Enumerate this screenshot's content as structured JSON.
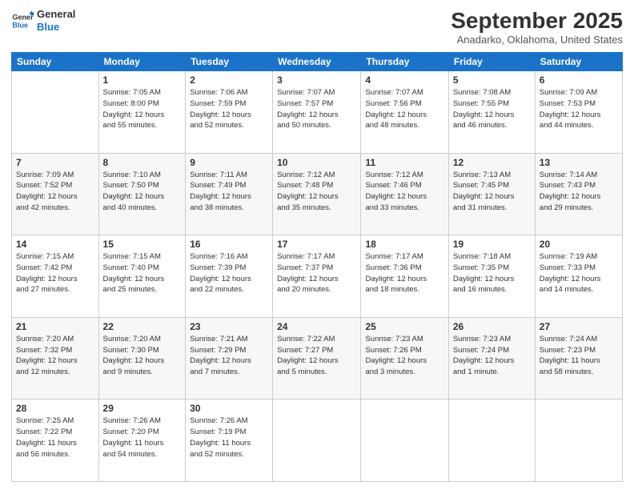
{
  "header": {
    "logo_line1": "General",
    "logo_line2": "Blue",
    "month": "September 2025",
    "location": "Anadarko, Oklahoma, United States"
  },
  "weekdays": [
    "Sunday",
    "Monday",
    "Tuesday",
    "Wednesday",
    "Thursday",
    "Friday",
    "Saturday"
  ],
  "weeks": [
    [
      {
        "day": "",
        "info": ""
      },
      {
        "day": "1",
        "info": "Sunrise: 7:05 AM\nSunset: 8:00 PM\nDaylight: 12 hours\nand 55 minutes."
      },
      {
        "day": "2",
        "info": "Sunrise: 7:06 AM\nSunset: 7:59 PM\nDaylight: 12 hours\nand 52 minutes."
      },
      {
        "day": "3",
        "info": "Sunrise: 7:07 AM\nSunset: 7:57 PM\nDaylight: 12 hours\nand 50 minutes."
      },
      {
        "day": "4",
        "info": "Sunrise: 7:07 AM\nSunset: 7:56 PM\nDaylight: 12 hours\nand 48 minutes."
      },
      {
        "day": "5",
        "info": "Sunrise: 7:08 AM\nSunset: 7:55 PM\nDaylight: 12 hours\nand 46 minutes."
      },
      {
        "day": "6",
        "info": "Sunrise: 7:09 AM\nSunset: 7:53 PM\nDaylight: 12 hours\nand 44 minutes."
      }
    ],
    [
      {
        "day": "7",
        "info": "Sunrise: 7:09 AM\nSunset: 7:52 PM\nDaylight: 12 hours\nand 42 minutes."
      },
      {
        "day": "8",
        "info": "Sunrise: 7:10 AM\nSunset: 7:50 PM\nDaylight: 12 hours\nand 40 minutes."
      },
      {
        "day": "9",
        "info": "Sunrise: 7:11 AM\nSunset: 7:49 PM\nDaylight: 12 hours\nand 38 minutes."
      },
      {
        "day": "10",
        "info": "Sunrise: 7:12 AM\nSunset: 7:48 PM\nDaylight: 12 hours\nand 35 minutes."
      },
      {
        "day": "11",
        "info": "Sunrise: 7:12 AM\nSunset: 7:46 PM\nDaylight: 12 hours\nand 33 minutes."
      },
      {
        "day": "12",
        "info": "Sunrise: 7:13 AM\nSunset: 7:45 PM\nDaylight: 12 hours\nand 31 minutes."
      },
      {
        "day": "13",
        "info": "Sunrise: 7:14 AM\nSunset: 7:43 PM\nDaylight: 12 hours\nand 29 minutes."
      }
    ],
    [
      {
        "day": "14",
        "info": "Sunrise: 7:15 AM\nSunset: 7:42 PM\nDaylight: 12 hours\nand 27 minutes."
      },
      {
        "day": "15",
        "info": "Sunrise: 7:15 AM\nSunset: 7:40 PM\nDaylight: 12 hours\nand 25 minutes."
      },
      {
        "day": "16",
        "info": "Sunrise: 7:16 AM\nSunset: 7:39 PM\nDaylight: 12 hours\nand 22 minutes."
      },
      {
        "day": "17",
        "info": "Sunrise: 7:17 AM\nSunset: 7:37 PM\nDaylight: 12 hours\nand 20 minutes."
      },
      {
        "day": "18",
        "info": "Sunrise: 7:17 AM\nSunset: 7:36 PM\nDaylight: 12 hours\nand 18 minutes."
      },
      {
        "day": "19",
        "info": "Sunrise: 7:18 AM\nSunset: 7:35 PM\nDaylight: 12 hours\nand 16 minutes."
      },
      {
        "day": "20",
        "info": "Sunrise: 7:19 AM\nSunset: 7:33 PM\nDaylight: 12 hours\nand 14 minutes."
      }
    ],
    [
      {
        "day": "21",
        "info": "Sunrise: 7:20 AM\nSunset: 7:32 PM\nDaylight: 12 hours\nand 12 minutes."
      },
      {
        "day": "22",
        "info": "Sunrise: 7:20 AM\nSunset: 7:30 PM\nDaylight: 12 hours\nand 9 minutes."
      },
      {
        "day": "23",
        "info": "Sunrise: 7:21 AM\nSunset: 7:29 PM\nDaylight: 12 hours\nand 7 minutes."
      },
      {
        "day": "24",
        "info": "Sunrise: 7:22 AM\nSunset: 7:27 PM\nDaylight: 12 hours\nand 5 minutes."
      },
      {
        "day": "25",
        "info": "Sunrise: 7:23 AM\nSunset: 7:26 PM\nDaylight: 12 hours\nand 3 minutes."
      },
      {
        "day": "26",
        "info": "Sunrise: 7:23 AM\nSunset: 7:24 PM\nDaylight: 12 hours\nand 1 minute."
      },
      {
        "day": "27",
        "info": "Sunrise: 7:24 AM\nSunset: 7:23 PM\nDaylight: 11 hours\nand 58 minutes."
      }
    ],
    [
      {
        "day": "28",
        "info": "Sunrise: 7:25 AM\nSunset: 7:22 PM\nDaylight: 11 hours\nand 56 minutes."
      },
      {
        "day": "29",
        "info": "Sunrise: 7:26 AM\nSunset: 7:20 PM\nDaylight: 11 hours\nand 54 minutes."
      },
      {
        "day": "30",
        "info": "Sunrise: 7:26 AM\nSunset: 7:19 PM\nDaylight: 11 hours\nand 52 minutes."
      },
      {
        "day": "",
        "info": ""
      },
      {
        "day": "",
        "info": ""
      },
      {
        "day": "",
        "info": ""
      },
      {
        "day": "",
        "info": ""
      }
    ]
  ]
}
